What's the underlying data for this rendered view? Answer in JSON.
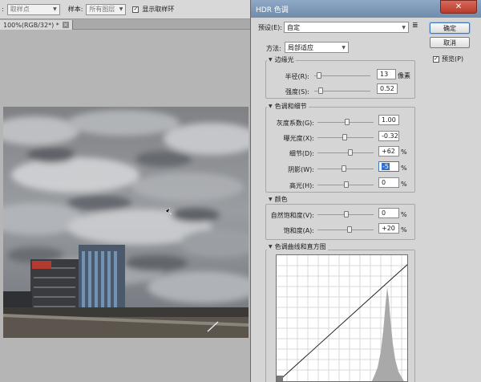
{
  "options_bar": {
    "sample_label_prefix": ":",
    "sample_point_value": "取样点",
    "sample_label": "样本:",
    "sample_layers_value": "所有图层",
    "show_ring_label": "显示取样环"
  },
  "document_tab": {
    "title": "100%(RGB/32*) *",
    "close_symbol": "×"
  },
  "dialog": {
    "title": "HDR 色调",
    "close_symbol": "✕",
    "ok_label": "确定",
    "cancel_label": "取消",
    "preview_label": "预览(P)",
    "preview_checked": true,
    "preset_label": "预设(E):",
    "preset_value": "自定",
    "method_label": "方法:",
    "method_value": "局部适应",
    "edge_glow": {
      "title": "边缘光",
      "radius_label": "半径(R):",
      "radius_value": "13",
      "radius_unit": "像素",
      "strength_label": "强度(S):",
      "strength_value": "0.52"
    },
    "tone_detail": {
      "title": "色调和细节",
      "gamma_label": "灰度系数(G):",
      "gamma_value": "1.00",
      "exposure_label": "曝光度(X):",
      "exposure_value": "-0.32",
      "detail_label": "细节(D):",
      "detail_value": "+62",
      "detail_unit": "%",
      "shadow_label": "阴影(W):",
      "shadow_value": "-5",
      "shadow_unit": "%",
      "highlight_label": "高光(H):",
      "highlight_value": "0",
      "highlight_unit": "%"
    },
    "color": {
      "title": "颜色",
      "vibrance_label": "自然饱和度(V):",
      "vibrance_value": "0",
      "vibrance_unit": "%",
      "saturation_label": "饱和度(A):",
      "saturation_value": "+20",
      "saturation_unit": "%"
    },
    "curve": {
      "title": "色调曲线和直方图"
    }
  }
}
